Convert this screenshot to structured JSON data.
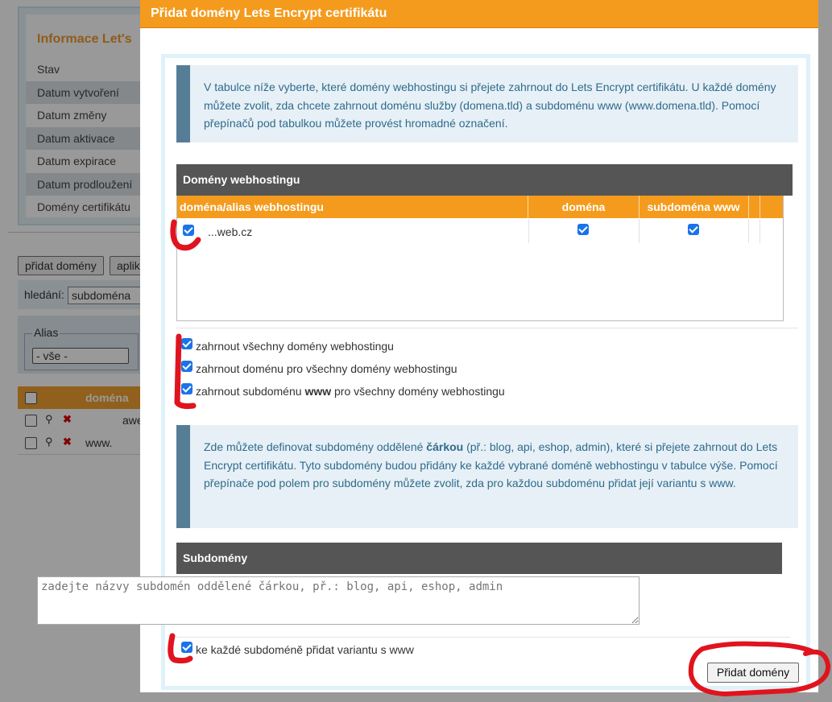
{
  "background": {
    "info_title": "Informace Let's",
    "info_rows": [
      "Stav",
      "Datum vytvoření",
      "Datum změny",
      "Datum aktivace",
      "Datum expirace",
      "Datum prodloužení",
      "Domény certifikátu"
    ],
    "buttons": [
      "přidat domény",
      "aplik"
    ],
    "search_label": "hledání:",
    "search_select": "subdoména",
    "alias_title": "Alias",
    "alias_select": "- vše -",
    "table_header": "doména",
    "table_rows": [
      "awel",
      "www."
    ]
  },
  "dialog": {
    "title": "Přidat domény Lets Encrypt certifikátu",
    "info1": "V tabulce níže vyberte, které domény webhostingu si přejete zahrnout do Lets Encrypt certifikátu. U každé domény můžete zvolit, zda chcete zahrnout doménu služby (domena.tld) a subdoménu www (www.domena.tld). Pomocí přepínačů pod tabulkou můžete provést hromadné označení.",
    "domains_section_title": "Domény webhostingu",
    "table": {
      "columns": [
        "doména/alias webhostingu",
        "doména",
        "subdoména www"
      ],
      "rows": [
        {
          "domain": "...web.cz",
          "domena_checked": true,
          "www_checked": true,
          "selected": true
        }
      ]
    },
    "options": {
      "include_all": "zahrnout všechny domény webhostingu",
      "include_domain": "zahrnout doménu pro všechny domény webhostingu",
      "include_www_pre": "zahrnout subdoménu ",
      "include_www_bold": "www",
      "include_www_post": " pro všechny domény webhostingu"
    },
    "info2_pre": "Zde můžete definovat subdomény oddělené ",
    "info2_bold": "čárkou",
    "info2_post": " (př.: blog, api, eshop, admin), které si přejete zahrnout do Lets Encrypt certifikátu. Tyto subdomény budou přidány ke každé vybrané doméně webhostingu v tabulce výše. Pomocí přepínače pod polem pro subdomény můžete zvolit, zda pro každou subdoménu přidat její variantu s www.",
    "subdomains_section_title": "Subdomény",
    "subdomains_placeholder": "zadejte názvy subdomén oddělené čárkou, př.: blog, api, eshop, admin",
    "www_variant_label": "ke každé subdoméně přidat variantu s www",
    "submit_label": "Přidat domény"
  },
  "colors": {
    "titlebar": "#f49b1d",
    "table_header": "#f49b1d",
    "section_header": "#555555",
    "checkbox": "#1a73e8",
    "annotation": "#e0141e",
    "info_text": "#2e6b8c"
  }
}
